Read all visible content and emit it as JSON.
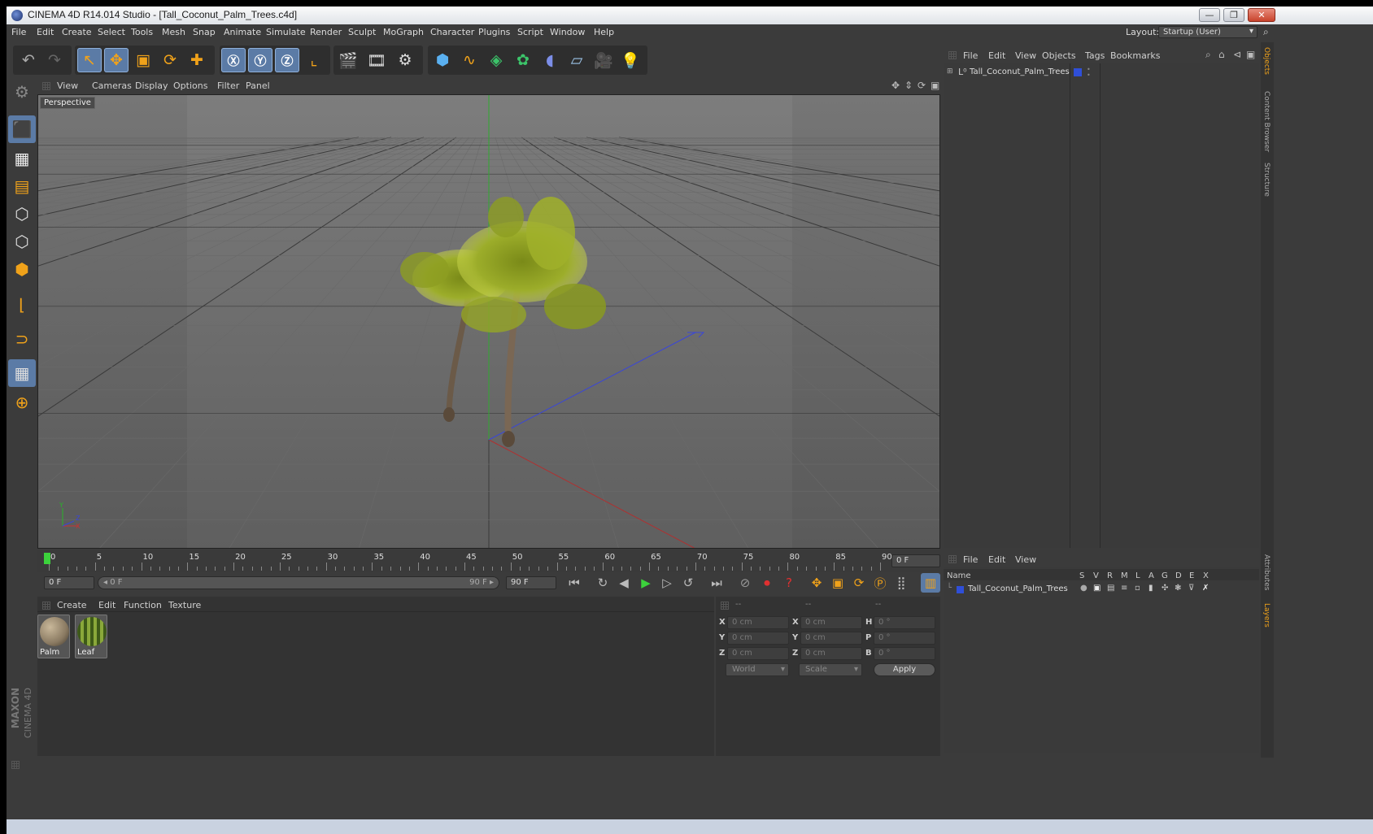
{
  "window": {
    "title": "CINEMA 4D R14.014 Studio - [Tall_Coconut_Palm_Trees.c4d]",
    "minimize_icon": "minimize-icon",
    "restore_icon": "restore-icon",
    "close_icon": "close-icon"
  },
  "menubar": {
    "items": [
      "File",
      "Edit",
      "Create",
      "Select",
      "Tools",
      "Mesh",
      "Snap",
      "Animate",
      "Simulate",
      "Render",
      "Sculpt",
      "MoGraph",
      "Character",
      "Plugins",
      "Script",
      "Window",
      "Help"
    ],
    "layout_label": "Layout:",
    "layout_value": "Startup (User)"
  },
  "toolbar": {
    "icons": [
      "undo-icon",
      "redo-icon",
      "select-arrow-icon",
      "move-icon",
      "scale-icon",
      "rotate-icon",
      "add-icon",
      "x-axis-icon",
      "y-axis-icon",
      "z-axis-icon",
      "coordinate-system-icon",
      "render-view-icon",
      "render-to-picture-viewer-icon",
      "render-settings-icon",
      "cube-icon",
      "spline-icon",
      "nurbs-icon",
      "array-icon",
      "deformer-icon",
      "floor-icon",
      "camera-icon",
      "light-icon"
    ]
  },
  "left_toolbar": {
    "icons": [
      "make-editable-icon",
      "model-mode-icon",
      "texture-mode-icon",
      "workplane-icon",
      "points-mode-icon",
      "edges-mode-icon",
      "polygons-mode-icon",
      "axis-icon",
      "magnet-icon",
      "snap-grid-icon",
      "lock-workplane-icon"
    ]
  },
  "viewport": {
    "menu": [
      "View",
      "Cameras",
      "Display",
      "Options",
      "Filter",
      "Panel"
    ],
    "label": "Perspective",
    "axis_labels": {
      "y": "Y",
      "z": "Z",
      "x": "X"
    }
  },
  "timeline": {
    "ticks": [
      "0",
      "5",
      "10",
      "15",
      "20",
      "25",
      "30",
      "35",
      "40",
      "45",
      "50",
      "55",
      "60",
      "65",
      "70",
      "75",
      "80",
      "85",
      "90"
    ],
    "current_frame": "0 F",
    "start_field": "0 F",
    "range_start": "0 F",
    "range_end": "90 F",
    "end_field": "90 F",
    "max_frame": 90
  },
  "playback": {
    "icons": [
      "go-to-start-icon",
      "play-backwards-loop-icon",
      "step-back-icon",
      "play-icon",
      "step-forward-icon",
      "loop-icon",
      "go-to-end-icon",
      "record-icon",
      "autokey-icon",
      "key-help-icon",
      "key-move-icon",
      "key-scale-icon",
      "key-rotate-icon",
      "key-param-icon",
      "key-pla-icon",
      "timeline-icon"
    ]
  },
  "material_panel": {
    "menu": [
      "Create",
      "Edit",
      "Function",
      "Texture"
    ],
    "materials": [
      {
        "name": "Palm",
        "color": "#8a7a62"
      },
      {
        "name": "Leaf",
        "color": "#5c7a2a"
      }
    ]
  },
  "coordinates": {
    "header": [
      "--",
      "--",
      "--"
    ],
    "rows": [
      {
        "l1": "X",
        "v1": "0 cm",
        "l2": "X",
        "v2": "0 cm",
        "l3": "H",
        "v3": "0 °"
      },
      {
        "l1": "Y",
        "v1": "0 cm",
        "l2": "Y",
        "v2": "0 cm",
        "l3": "P",
        "v3": "0 °"
      },
      {
        "l1": "Z",
        "v1": "0 cm",
        "l2": "Z",
        "v2": "0 cm",
        "l3": "B",
        "v3": "0 °"
      }
    ],
    "world_dropdown": "World",
    "scale_dropdown": "Scale",
    "apply_label": "Apply"
  },
  "object_manager": {
    "menu": [
      "File",
      "Edit",
      "View",
      "Objects",
      "Tags",
      "Bookmarks"
    ],
    "object_name": "Tall_Coconut_Palm_Trees",
    "object_color": "#2f4fd8"
  },
  "layers_manager": {
    "menu": [
      "File",
      "Edit",
      "View"
    ],
    "columns": [
      "Name",
      "S",
      "V",
      "R",
      "M",
      "L",
      "A",
      "G",
      "D",
      "E",
      "X"
    ],
    "layer_name": "Tall_Coconut_Palm_Trees",
    "layer_color": "#2f4fd8"
  },
  "side_tabs": {
    "top": [
      "Objects",
      "Content Browser",
      "Structure"
    ],
    "bottom": [
      "Attributes",
      "Layers"
    ]
  },
  "branding": {
    "line1": "MAXON",
    "line2": "CINEMA 4D"
  },
  "colors": {
    "accent_orange": "#f0a21a",
    "accent_blue": "#5b7ba6",
    "x_axis": "#c83232",
    "y_axis": "#28b428",
    "z_axis": "#3a46d8"
  }
}
